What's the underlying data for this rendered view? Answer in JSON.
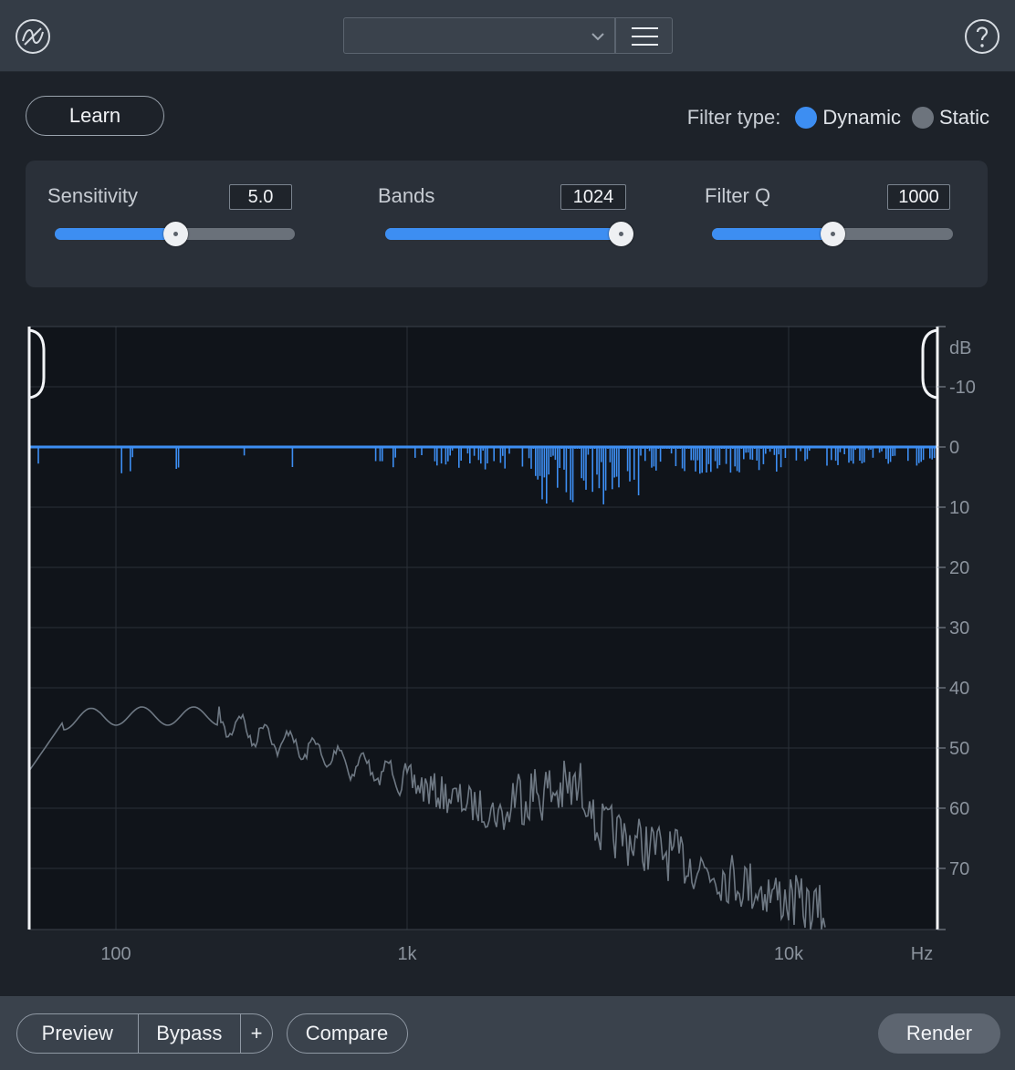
{
  "header": {
    "preset_value": "",
    "logo_icon": "izotope-logo-icon",
    "menu_icon": "hamburger-menu-icon",
    "help_icon": "help-icon"
  },
  "learn_label": "Learn",
  "filter_type": {
    "label": "Filter type:",
    "options": [
      {
        "label": "Dynamic",
        "selected": true,
        "color": "#3d8ef2"
      },
      {
        "label": "Static",
        "selected": false,
        "color": "#6d747d"
      }
    ]
  },
  "controls": [
    {
      "name": "Sensitivity",
      "value": "5.0",
      "level": 0.5
    },
    {
      "name": "Bands",
      "value": "1024",
      "level": 1.0
    },
    {
      "name": "Filter Q",
      "value": "1000",
      "level": 0.5
    }
  ],
  "graph": {
    "db_unit": "dB",
    "db_ticks": [
      "-10",
      "0",
      "10",
      "20",
      "30",
      "40",
      "50",
      "60",
      "70"
    ],
    "freq_ticks": [
      "100",
      "1k",
      "10k"
    ],
    "freq_unit": "Hz",
    "spectrum_color": "#6e7883",
    "gain_color": "#3d8ef2"
  },
  "footer": {
    "preview": "Preview",
    "bypass": "Bypass",
    "plus": "+",
    "compare": "Compare",
    "render": "Render"
  }
}
